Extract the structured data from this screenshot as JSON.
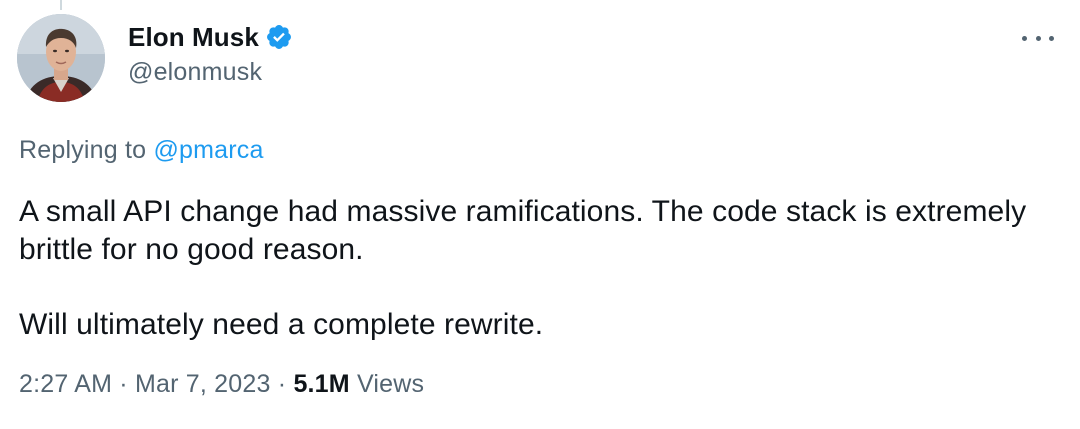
{
  "author": {
    "name": "Elon Musk",
    "handle": "@elonmusk",
    "verified": true,
    "avatar_icon": "profile-photo"
  },
  "reply": {
    "prefix": "Replying to",
    "handle": "@pmarca"
  },
  "tweet": {
    "paragraphs": [
      "A small API change had massive ramifications. The code stack is extremely brittle for no good reason.",
      "Will ultimately need a complete rewrite."
    ]
  },
  "meta": {
    "time": "2:27 AM",
    "separator": "·",
    "date": "Mar 7, 2023",
    "views_count": "5.1M",
    "views_label": "Views"
  },
  "colors": {
    "primary_text": "#0f1419",
    "secondary_text": "#536471",
    "link": "#1d9bf0",
    "verified_badge": "#1d9bf0"
  },
  "icons": {
    "verified": "verified-badge-icon",
    "more": "more-options-icon"
  }
}
